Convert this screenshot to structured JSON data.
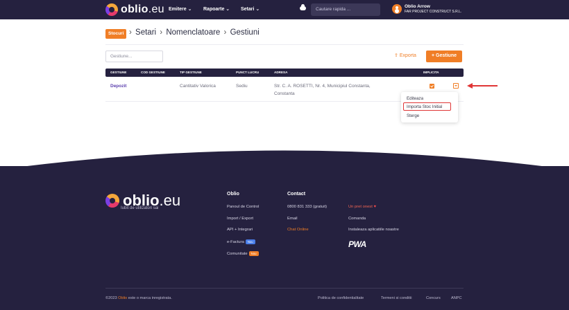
{
  "topbar": {
    "logo_main": "oblio",
    "logo_suffix": ".eu",
    "nav": [
      {
        "label": "Emitere ⌄"
      },
      {
        "label": "Rapoarte ⌄"
      },
      {
        "label": "Setari ⌄"
      }
    ],
    "search_placeholder": "Cautare rapida ...",
    "user_name": "Oblio Arrow",
    "user_company": "FAR PROJECT CONSTRUCT S.R.L."
  },
  "breadcrumb": {
    "badge": "Stocuri",
    "items": [
      "Setari",
      "Nomenclatoare",
      "Gestiuni"
    ],
    "separator": "›"
  },
  "toolbar": {
    "filter_placeholder": "Gestiune...",
    "export_label": "Exporta",
    "add_label": "+ Gestiune"
  },
  "table": {
    "headers": [
      "GESTIUNE",
      "COD GESTIUNE",
      "TIP GESTIUNE",
      "PUNCT LUCRU",
      "ADRESA",
      "IMPLICITA"
    ],
    "rows": [
      {
        "gestiune": "Depozit",
        "cod": "",
        "tip": "Cantitativ Valorica",
        "punct": "Sediu",
        "adresa_line1": "Str. C. A. ROSETTI, Nr. 4, Municipiul Constanta,",
        "adresa_line2": "Constanta",
        "implicita": true
      }
    ]
  },
  "row_menu": {
    "items": [
      "Editeaza",
      "Importa Stoc Initial",
      "Sterge"
    ],
    "highlighted": "Importa Stoc Initial"
  },
  "footer": {
    "logo_main": "oblio",
    "logo_suffix": ".eu",
    "tagline": "Iubit de utilizatori sai",
    "col1": {
      "title": "Oblio",
      "links": [
        "Panoul de Control",
        "Import / Export",
        "API + Integrari",
        "e-Factura",
        "Comunitate"
      ],
      "efactura_badge": "Nou",
      "comunitate_badge": "Nou"
    },
    "col2": {
      "title": "Contact",
      "phone": "0800 831 333 (gratuit)",
      "email": "Email",
      "chat": "Chat Online"
    },
    "col3": {
      "promo": "Un pret onest",
      "order": "Comanda",
      "install": "Instaleaza aplicatiile noastre",
      "pwa": "PWA"
    },
    "bottom": {
      "year": "©2023",
      "brand": "Oblio",
      "trademark": "este o marca inregistrata.",
      "links": [
        "Politica de confidentialitate",
        "Termeni si conditii",
        "Concurs",
        "ANPC"
      ]
    }
  },
  "colors": {
    "navy": "#25213f",
    "accent": "#f07e26",
    "purple_link": "#5b3fae",
    "highlight_red": "#e03535"
  }
}
